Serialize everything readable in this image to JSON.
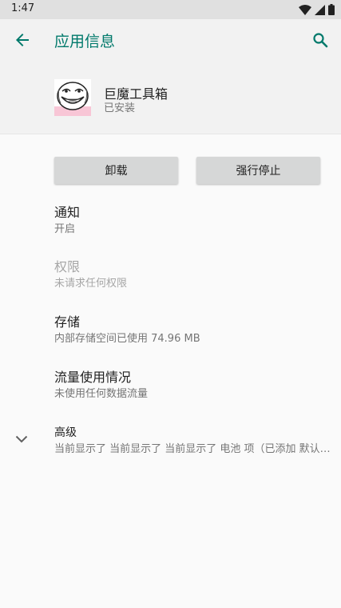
{
  "status_bar": {
    "time": "1:47"
  },
  "app_bar": {
    "title": "应用信息"
  },
  "app": {
    "name": "巨魔工具箱",
    "status": "已安装"
  },
  "buttons": {
    "uninstall": "卸载",
    "force_stop": "强行停止"
  },
  "preferences": [
    {
      "title": "通知",
      "summary": "开启",
      "enabled": true
    },
    {
      "title": "权限",
      "summary": "未请求任何权限",
      "enabled": false
    },
    {
      "title": "存储",
      "summary": "内部存储空间已使用 74.96 MB",
      "enabled": true
    },
    {
      "title": "流量使用情况",
      "summary": "未使用任何数据流量",
      "enabled": true
    }
  ],
  "advanced": {
    "title": "高级",
    "summary": "当前显示了 当前显示了 当前显示了 电池 项（已添加 默认应用）"
  },
  "colors": {
    "accent": "#00796b",
    "background": "#fafafa",
    "header": "#f2f2f2",
    "status_bar": "#e0e0e0",
    "button": "#d6d7d7"
  }
}
